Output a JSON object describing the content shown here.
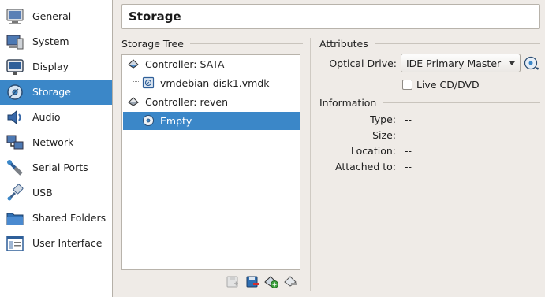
{
  "sidebar": {
    "items": [
      {
        "label": "General",
        "icon": "general-icon",
        "selected": false
      },
      {
        "label": "System",
        "icon": "system-icon",
        "selected": false
      },
      {
        "label": "Display",
        "icon": "display-icon",
        "selected": false
      },
      {
        "label": "Storage",
        "icon": "storage-icon",
        "selected": true
      },
      {
        "label": "Audio",
        "icon": "audio-icon",
        "selected": false
      },
      {
        "label": "Network",
        "icon": "network-icon",
        "selected": false
      },
      {
        "label": "Serial Ports",
        "icon": "serial-ports-icon",
        "selected": false
      },
      {
        "label": "USB",
        "icon": "usb-icon",
        "selected": false
      },
      {
        "label": "Shared Folders",
        "icon": "shared-folders-icon",
        "selected": false
      },
      {
        "label": "User Interface",
        "icon": "user-interface-icon",
        "selected": false
      }
    ]
  },
  "header": {
    "title": "Storage"
  },
  "storage_tree": {
    "heading": "Storage Tree",
    "items": [
      {
        "label": "Controller: SATA",
        "type": "controller",
        "icon": "sata-controller-icon"
      },
      {
        "label": "vmdebian-disk1.vmdk",
        "type": "disk",
        "icon": "hard-disk-icon"
      },
      {
        "label": "Controller: reven",
        "type": "controller",
        "icon": "ide-controller-icon"
      },
      {
        "label": "Empty",
        "type": "optical",
        "icon": "optical-disc-icon",
        "selected": true
      }
    ],
    "toolbar": [
      {
        "name": "add-attachment-button",
        "icon": "add-attachment-icon",
        "enabled": false
      },
      {
        "name": "remove-attachment-button",
        "icon": "remove-attachment-icon",
        "enabled": true
      },
      {
        "name": "add-controller-button",
        "icon": "add-controller-icon",
        "enabled": true
      },
      {
        "name": "remove-controller-button",
        "icon": "remove-controller-icon",
        "enabled": true
      }
    ]
  },
  "attributes": {
    "heading": "Attributes",
    "optical_drive_label": "Optical Drive:",
    "optical_drive_value": "IDE Primary Master",
    "live_cd_label": "Live CD/DVD",
    "live_cd_checked": false
  },
  "information": {
    "heading": "Information",
    "type_label": "Type:",
    "type_value": "--",
    "size_label": "Size:",
    "size_value": "--",
    "location_label": "Location:",
    "location_value": "--",
    "attached_label": "Attached to:",
    "attached_value": "--"
  },
  "colors": {
    "selection": "#3b87c8",
    "window_bg": "#efebe7"
  }
}
